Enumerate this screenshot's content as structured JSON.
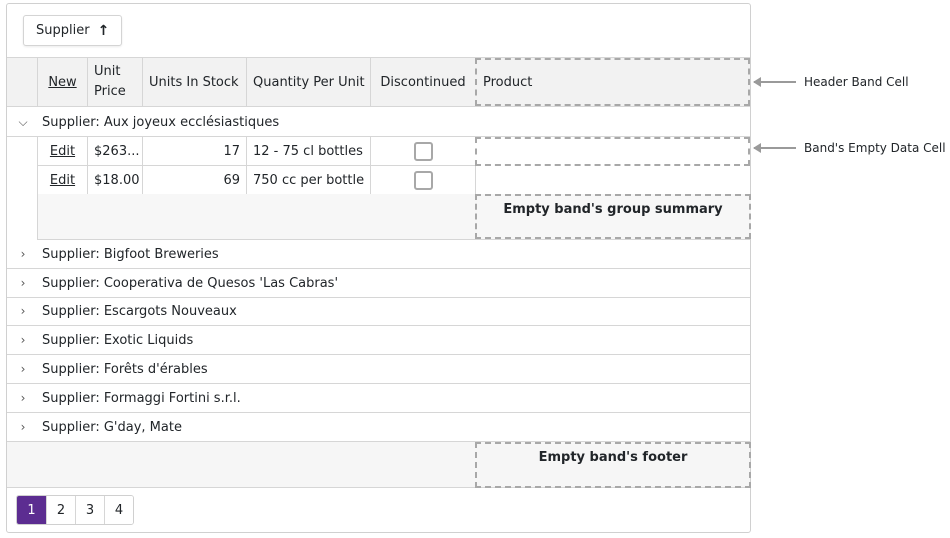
{
  "group_panel": {
    "chip_label": "Supplier",
    "sort_icon": "arrow-up-icon"
  },
  "header": {
    "new_link": "New",
    "columns": [
      "Unit Price",
      "Units In Stock",
      "Quantity Per Unit",
      "Discontinued",
      "Product"
    ]
  },
  "expanded_group": {
    "label": "Supplier: Aux joyeux ecclésiastiques",
    "rows": [
      {
        "edit": "Edit",
        "unit_price": "$263...",
        "units_in_stock": "17",
        "quantity_per_unit": "12 - 75 cl bottles",
        "discontinued": false
      },
      {
        "edit": "Edit",
        "unit_price": "$18.00",
        "units_in_stock": "69",
        "quantity_per_unit": "750 cc per bottle",
        "discontinued": false
      }
    ],
    "summary_text": "Empty band's group summary"
  },
  "collapsed_groups": [
    "Supplier: Bigfoot Breweries",
    "Supplier: Cooperativa de Quesos 'Las Cabras'",
    "Supplier: Escargots Nouveaux",
    "Supplier: Exotic Liquids",
    "Supplier: Forêts d'érables",
    "Supplier: Formaggi Fortini s.r.l.",
    "Supplier: G'day, Mate"
  ],
  "footer": {
    "band_text": "Empty band's footer"
  },
  "pager": {
    "pages": [
      "1",
      "2",
      "3",
      "4"
    ],
    "active": "1",
    "active_color": "#5c2d91"
  },
  "callouts": {
    "header_band": "Header Band Cell",
    "empty_data": "Band's Empty Data Cell"
  }
}
